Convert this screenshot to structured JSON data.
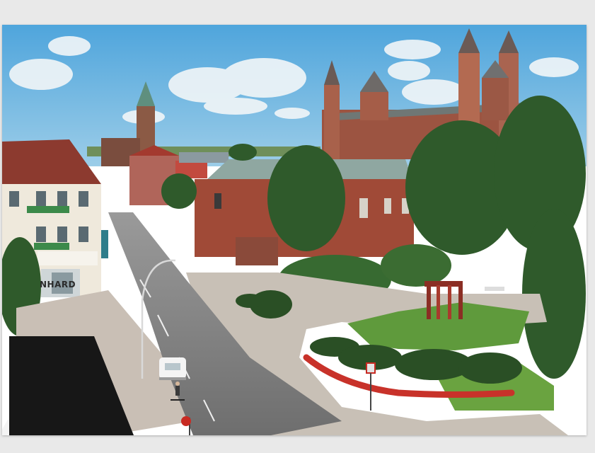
{
  "photo": {
    "shop_sign": "NHARD"
  },
  "colors": {
    "background": "#e9e9e9",
    "sky": "#6fb7e2",
    "sandstone": "#a85843",
    "roof_green": "#7f9e96",
    "foliage": "#2f5a2b",
    "lawn": "#5f9a3c",
    "road": "#7a7a7a",
    "flowers": "#c8322a"
  }
}
